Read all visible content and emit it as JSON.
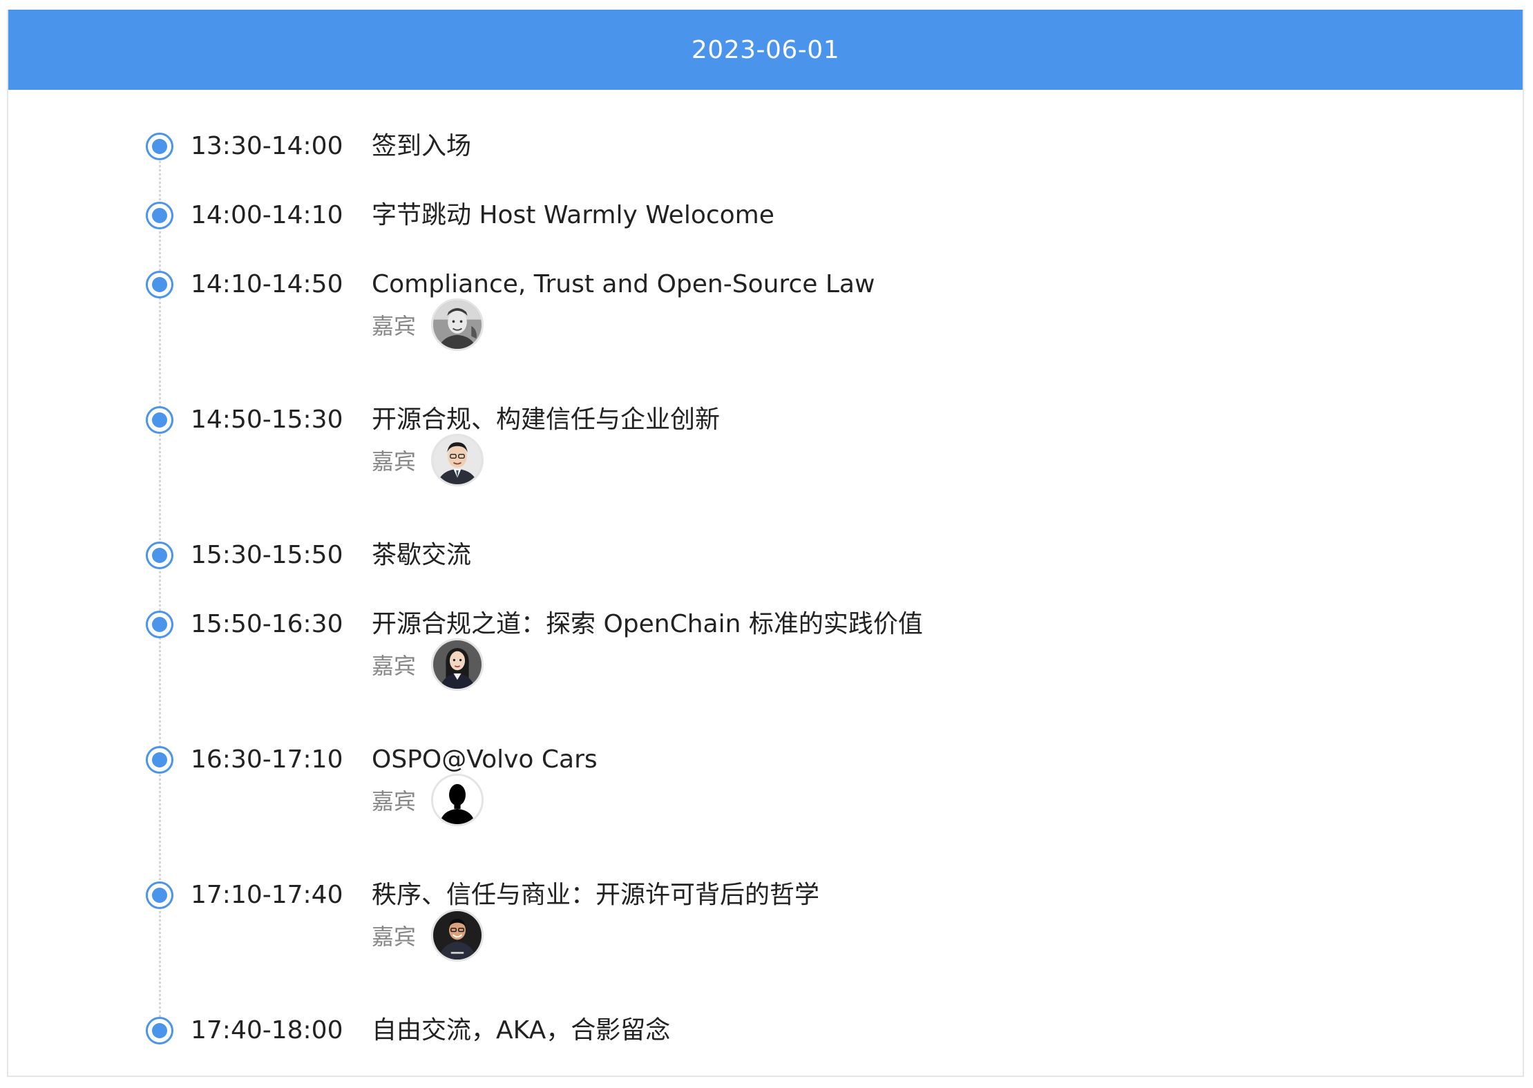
{
  "header": {
    "date": "2023-06-01"
  },
  "colors": {
    "accent": "#4a94ec",
    "text": "#222222",
    "muted": "#888888"
  },
  "schedule": [
    {
      "time": "13:30-14:00",
      "title": "签到入场"
    },
    {
      "time": "14:00-14:10",
      "title": "字节跳动 Host Warmly Welocome"
    },
    {
      "time": "14:10-14:50",
      "title": "Compliance, Trust and Open-Source Law",
      "speaker_label": "嘉宾",
      "avatar": "avatar-1"
    },
    {
      "time": "14:50-15:30",
      "title": "开源合规、构建信任与企业创新",
      "speaker_label": "嘉宾",
      "avatar": "avatar-2"
    },
    {
      "time": "15:30-15:50",
      "title": "茶歇交流"
    },
    {
      "time": "15:50-16:30",
      "title": "开源合规之道：探索 OpenChain 标准的实践价值",
      "speaker_label": "嘉宾",
      "avatar": "avatar-3"
    },
    {
      "time": "16:30-17:10",
      "title": "OSPO@Volvo Cars",
      "speaker_label": "嘉宾",
      "avatar": "silhouette-avatar"
    },
    {
      "time": "17:10-17:40",
      "title": "秩序、信任与商业：开源许可背后的哲学",
      "speaker_label": "嘉宾",
      "avatar": "avatar-5"
    },
    {
      "time": "17:40-18:00",
      "title": "自由交流，AKA，合影留念"
    }
  ]
}
